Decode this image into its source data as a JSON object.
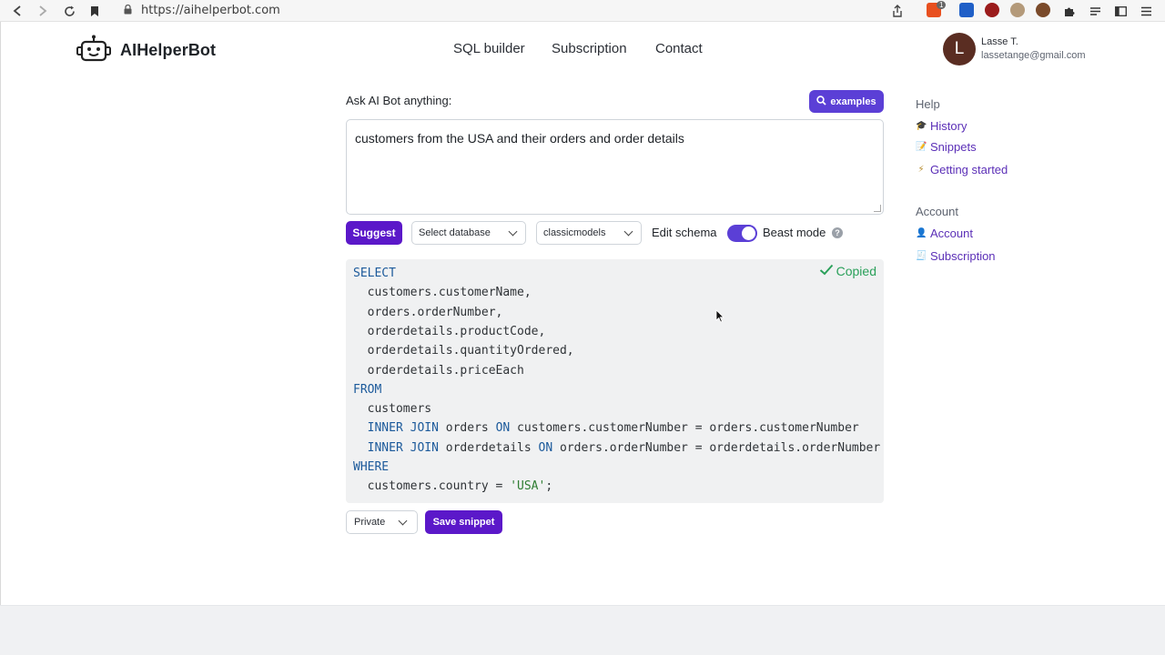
{
  "browser": {
    "url": "https://aihelperbot.com",
    "extension_badge": "1"
  },
  "header": {
    "logo_text": "AIHelperBot",
    "nav": [
      "SQL builder",
      "Subscription",
      "Contact"
    ],
    "user": {
      "initial": "L",
      "name": "Lasse T.",
      "email": "lassetange@gmail.com"
    }
  },
  "main": {
    "ask_label": "Ask AI Bot anything:",
    "examples_label": "examples",
    "prompt_value": "customers from the USA and their orders and order details",
    "suggest_label": "Suggest",
    "database_select": "Select database",
    "schema_select": "classicmodels",
    "edit_schema_label": "Edit schema",
    "beast_mode_label": "Beast mode",
    "beast_mode_on": true,
    "copied_label": "Copied",
    "code_lines": [
      "SELECT",
      "  customers.customerName,",
      "  orders.orderNumber,",
      "  orderdetails.productCode,",
      "  orderdetails.quantityOrdered,",
      "  orderdetails.priceEach",
      "FROM",
      "  customers",
      "  INNER JOIN orders ON customers.customerNumber = orders.customerNumber",
      "  INNER JOIN orderdetails ON orders.orderNumber = orderdetails.orderNumber",
      "WHERE",
      "  customers.country = 'USA';"
    ],
    "visibility_select": "Private",
    "save_snippet_label": "Save snippet"
  },
  "sidebar": {
    "help_heading": "Help",
    "help_links": [
      "History",
      "Snippets",
      "Getting started"
    ],
    "account_heading": "Account",
    "account_links": [
      "Account",
      "Subscription"
    ]
  },
  "colors": {
    "primary_button": "#5b18c9",
    "examples_button": "#5b3fd6",
    "link": "#5b2fb7",
    "copied": "#2aa05a",
    "sql_keyword": "#1c5a9b",
    "sql_string": "#2e7d32"
  }
}
